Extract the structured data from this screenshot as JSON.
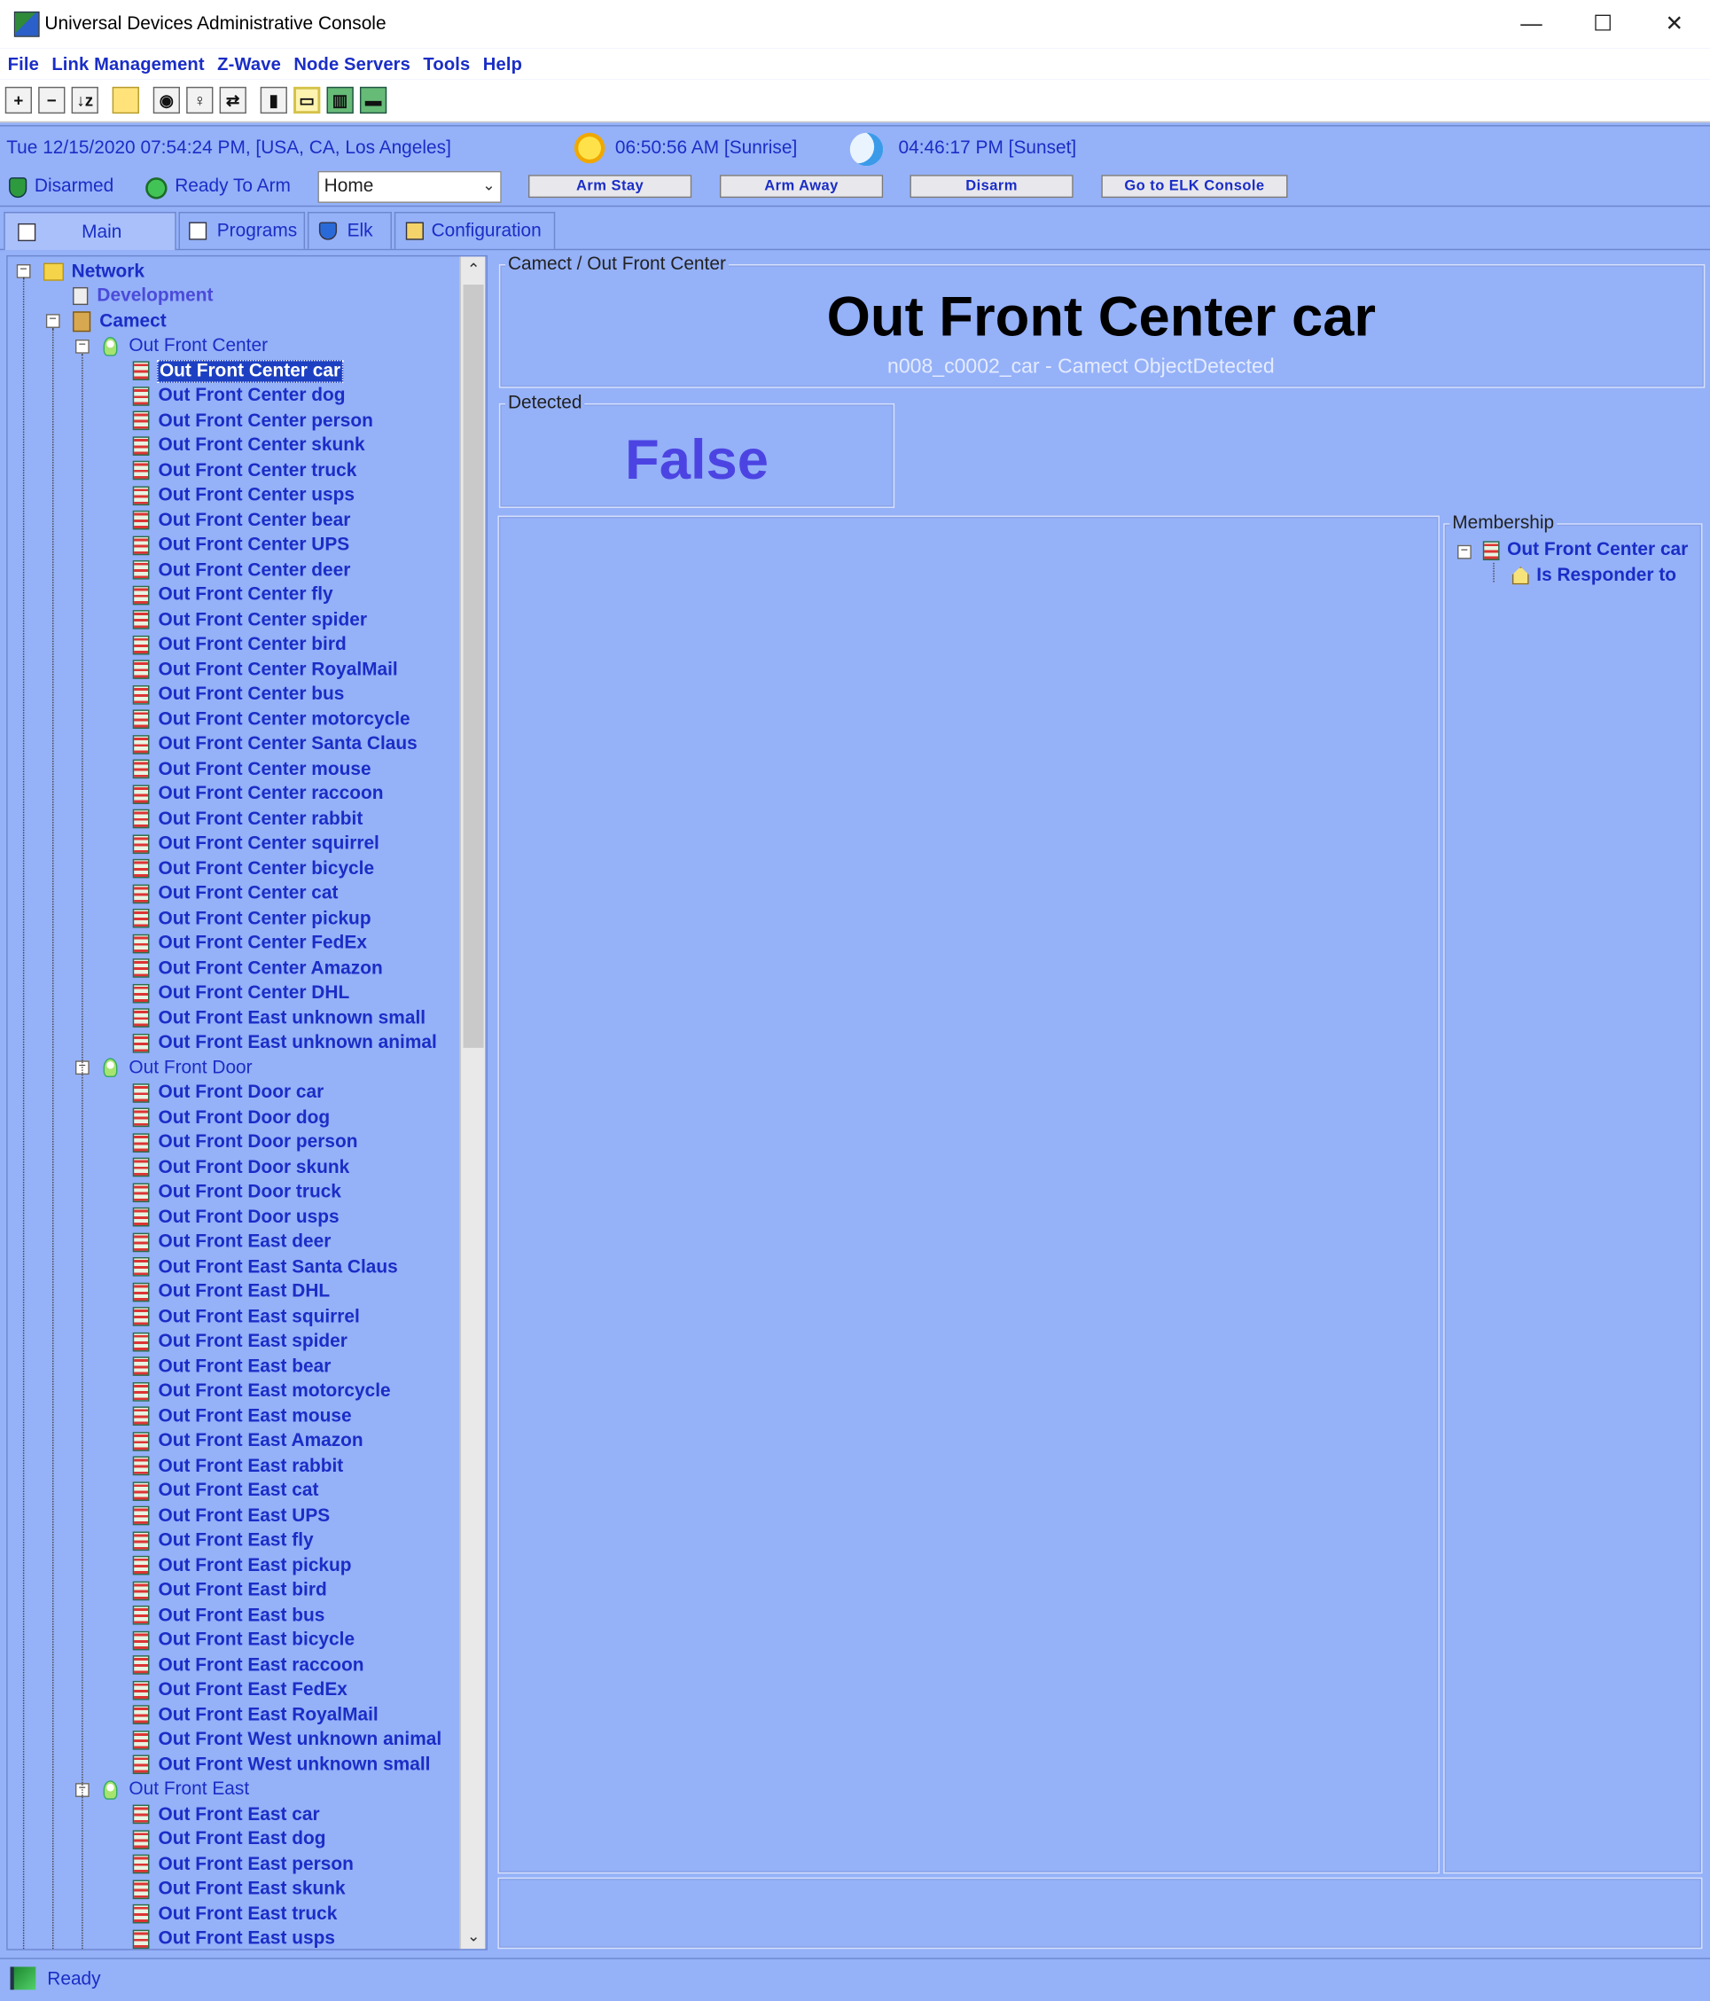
{
  "window": {
    "title": "Universal Devices Administrative Console",
    "controls": [
      "—",
      "☐",
      "✕"
    ]
  },
  "menu": [
    "File",
    "Link Management",
    "Z-Wave",
    "Node Servers",
    "Tools",
    "Help"
  ],
  "toolbar": {
    "icons": [
      "expand-all-icon",
      "collapse-all-icon",
      "sort-icon",
      "note-icon",
      "color-icon",
      "bulb-icon",
      "link-icon",
      "chart-icon",
      "window-icon",
      "barcode-icon",
      "battery-icon"
    ],
    "labels": [
      "+",
      "−",
      "↓z",
      "",
      "◉",
      "♀",
      "⇄",
      "▮",
      "▭",
      "▥",
      "▬"
    ]
  },
  "info": {
    "datetime": "Tue 12/15/2020 07:54:24 PM,  [USA, CA, Los Angeles]",
    "sunrise": "06:50:56 AM [Sunrise]",
    "sunset": "04:46:17 PM [Sunset]",
    "disarmed": "Disarmed",
    "ready": "Ready To Arm",
    "mode": "Home",
    "buttons": {
      "arm_stay": "Arm Stay",
      "arm_away": "Arm Away",
      "disarm": "Disarm",
      "elk": "Go to ELK Console"
    }
  },
  "tabs": [
    "Main",
    "Programs",
    "Elk",
    "Configuration"
  ],
  "tree": {
    "root": "Network",
    "development": "Development",
    "camect": "Camect",
    "groups": [
      {
        "name": "Out Front Center",
        "items": [
          "Out Front Center car",
          "Out Front Center dog",
          "Out Front Center person",
          "Out Front Center skunk",
          "Out Front Center truck",
          "Out Front Center usps",
          "Out Front Center bear",
          "Out Front Center UPS",
          "Out Front Center deer",
          "Out Front Center fly",
          "Out Front Center spider",
          "Out Front Center bird",
          "Out Front Center RoyalMail",
          "Out Front Center bus",
          "Out Front Center motorcycle",
          "Out Front Center Santa Claus",
          "Out Front Center mouse",
          "Out Front Center raccoon",
          "Out Front Center rabbit",
          "Out Front Center squirrel",
          "Out Front Center bicycle",
          "Out Front Center cat",
          "Out Front Center pickup",
          "Out Front Center FedEx",
          "Out Front Center Amazon",
          "Out Front Center DHL",
          "Out Front East unknown small",
          "Out Front East unknown animal"
        ]
      },
      {
        "name": "Out Front Door",
        "items": [
          "Out Front Door car",
          "Out Front Door dog",
          "Out Front Door person",
          "Out Front Door skunk",
          "Out Front Door truck",
          "Out Front Door usps",
          "Out Front East deer",
          "Out Front East Santa Claus",
          "Out Front East DHL",
          "Out Front East squirrel",
          "Out Front East spider",
          "Out Front East bear",
          "Out Front East motorcycle",
          "Out Front East mouse",
          "Out Front East Amazon",
          "Out Front East rabbit",
          "Out Front East cat",
          "Out Front East UPS",
          "Out Front East fly",
          "Out Front East pickup",
          "Out Front East bird",
          "Out Front East bus",
          "Out Front East bicycle",
          "Out Front East raccoon",
          "Out Front East FedEx",
          "Out Front East RoyalMail",
          "Out Front West unknown animal",
          "Out Front West unknown small"
        ]
      },
      {
        "name": "Out Front East",
        "items": [
          "Out Front East car",
          "Out Front East dog",
          "Out Front East person",
          "Out Front East skunk",
          "Out Front East truck",
          "Out Front East usps"
        ]
      }
    ],
    "selected": "Out Front Center car"
  },
  "detail": {
    "breadcrumb": "Camect / Out Front Center",
    "title": "Out Front Center car",
    "subtitle": "n008_c0002_car - Camect ObjectDetected",
    "detected_label": "Detected",
    "detected_value": "False",
    "membership_label": "Membership",
    "membership_item": "Out Front Center car",
    "membership_sub": "Is Responder to"
  },
  "status": "Ready"
}
